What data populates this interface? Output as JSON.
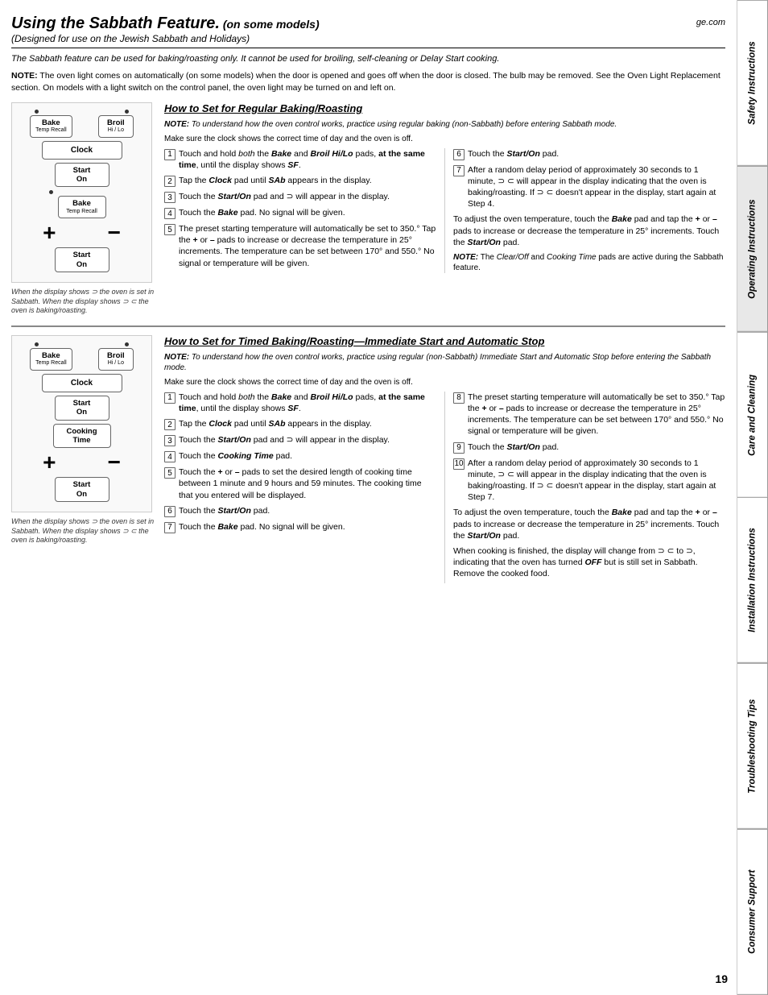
{
  "title": "Using the Sabbath Feature.",
  "title_suffix": " (on some models)",
  "subtitle": "(Designed for use on the Jewish Sabbath and Holidays)",
  "ge_com": "ge.com",
  "intro_text": "The Sabbath feature can be used for baking/roasting only. It cannot be used for broiling, self-cleaning or Delay Start cooking.",
  "note1": "NOTE: The oven light comes on automatically (on some models) when the door is opened and goes off when the door is closed. The bulb may be removed. See the Oven Light Replacement section. On models with a light switch on the control panel, the oven light may be turned on and left on.",
  "section1": {
    "header": "How to Set for Regular Baking/Roasting",
    "note_intro": "NOTE: To understand how the oven control works, practice using regular baking (non-Sabbath) before entering Sabbath mode.",
    "make_sure": "Make sure the clock shows the correct time of day and the oven is off.",
    "steps_left": [
      {
        "num": "1",
        "text": "Touch and hold <em>both</em> the <strong><em>Bake</em></strong> and <strong><em>Broil Hi/Lo</em></strong> pads, <strong>at the same time</strong>, until the display shows <em><strong>SF</strong></em>."
      },
      {
        "num": "2",
        "text": "Tap the <strong><em>Clock</em></strong> pad until <strong><em>SAb</em></strong> appears in the display."
      },
      {
        "num": "3",
        "text": "Touch the <strong><em>Start/On</em></strong> pad and ⊃ will appear in the display."
      },
      {
        "num": "4",
        "text": "Touch the <strong><em>Bake</em></strong> pad. No signal will be given."
      },
      {
        "num": "5",
        "text": "The preset starting temperature will automatically be set to 350.° Tap the <strong>+</strong> or <strong>–</strong> pads to increase or decrease the temperature in 25° increments. The temperature can be set between 170° and 550.° No signal or temperature will be given."
      }
    ],
    "steps_right": [
      {
        "num": "6",
        "text": "Touch the <strong><em>Start/On</em></strong> pad."
      },
      {
        "num": "7",
        "text": "After a random delay period of approximately 30 seconds to 1 minute, ⊃ ⊂ will appear in the display indicating that the oven is baking/roasting. If ⊃ ⊂ doesn't appear in the display, start again at Step 4."
      }
    ],
    "adjust_text": "To adjust the oven temperature, touch the <strong><em>Bake</em></strong> pad and tap the <strong>+</strong> or <strong>–</strong> pads to increase or decrease the temperature in 25° increments. Touch the <strong><em>Start/On</em></strong> pad.",
    "note_end": "NOTE: The <em>Clear/Off</em> and <em>Cooking Time</em> pads are active during the Sabbath feature.",
    "diagram": {
      "bake_label": "Bake",
      "bake_sublabel": "Temp Recall",
      "broil_label": "Broil",
      "broil_sublabel": "Hi / Lo",
      "clock_label": "Clock",
      "start_label": "Start",
      "start_label2": "On",
      "bake2_label": "Bake",
      "bake2_sublabel": "Temp Recall",
      "start2_label": "Start",
      "start2_label2": "On"
    },
    "caption": "When the display shows ⊃ the oven is set in Sabbath. When the display shows ⊃ ⊂ the oven is baking/roasting."
  },
  "section2": {
    "header": "How to Set for Timed Baking/Roasting—Immediate Start and Automatic Stop",
    "note_intro": "NOTE: To understand how the oven control works, practice using regular (non-Sabbath) Immediate Start and Automatic Stop before entering the Sabbath mode.",
    "make_sure": "Make sure the clock shows the correct time of day and the oven is off.",
    "steps_left": [
      {
        "num": "1",
        "text": "Touch and hold <em>both</em> the <strong><em>Bake</em></strong> and <strong><em>Broil Hi/Lo</em></strong> pads, <strong>at the same time</strong>, until the display shows <em><strong>SF</strong></em>."
      },
      {
        "num": "2",
        "text": "Tap the <strong><em>Clock</em></strong> pad until <strong><em>SAb</em></strong> appears in the display."
      },
      {
        "num": "3",
        "text": "Touch the <strong><em>Start/On</em></strong> pad and ⊃ will appear in the display."
      },
      {
        "num": "4",
        "text": "Touch the <strong><em>Cooking Time</em></strong> pad."
      },
      {
        "num": "5",
        "text": "Touch the <strong>+</strong> or <strong>–</strong> pads to set the desired length of cooking time between 1 minute and 9 hours and 59 minutes. The cooking time that you entered will be displayed."
      },
      {
        "num": "6",
        "text": "Touch the <strong><em>Start/On</em></strong> pad."
      },
      {
        "num": "7",
        "text": "Touch the <strong><em>Bake</em></strong> pad. No signal will be given."
      }
    ],
    "steps_right": [
      {
        "num": "8",
        "text": "The preset starting temperature will automatically be set to 350.° Tap the <strong>+</strong> or <strong>–</strong> pads to increase or decrease the temperature in 25° increments. The temperature can be set between 170° and 550.° No signal or temperature will be given."
      },
      {
        "num": "9",
        "text": "Touch the <strong><em>Start/On</em></strong> pad."
      },
      {
        "num": "10",
        "text": "After a random delay period of approximately 30 seconds to 1 minute, ⊃ ⊂ will appear in the display indicating that the oven is baking/roasting. If ⊃ ⊂ doesn't appear in the display, start again at Step 7."
      }
    ],
    "adjust_text": "To adjust the oven temperature, touch the <strong><em>Bake</em></strong> pad and tap the <strong>+</strong> or <strong>–</strong> pads to increase or decrease the temperature in 25° increments. Touch the <strong><em>Start/On</em></strong> pad.",
    "end_note": "When cooking is finished, the display will change from ⊃ ⊂ to ⊃, indicating that the oven has turned <strong><em>OFF</em></strong> but is still set in Sabbath. Remove the cooked food.",
    "diagram": {
      "bake_label": "Bake",
      "bake_sublabel": "Temp Recall",
      "broil_label": "Broil",
      "broil_sublabel": "Hi / Lo",
      "clock_label": "Clock",
      "start_label": "Start",
      "start_label2": "On",
      "cooking_time_label": "Cooking",
      "cooking_time_label2": "Time",
      "start2_label": "Start",
      "start2_label2": "On"
    },
    "caption": "When the display shows ⊃ the oven is set in Sabbath. When the display shows ⊃ ⊂ the oven is baking/roasting."
  },
  "side_tabs": [
    {
      "label": "Safety Instructions",
      "active": false
    },
    {
      "label": "Operating Instructions",
      "active": true
    },
    {
      "label": "Care and Cleaning",
      "active": false
    },
    {
      "label": "Installation Instructions",
      "active": false
    },
    {
      "label": "Troubleshooting Tips",
      "active": false
    },
    {
      "label": "Consumer Support",
      "active": false
    }
  ],
  "page_number": "19"
}
